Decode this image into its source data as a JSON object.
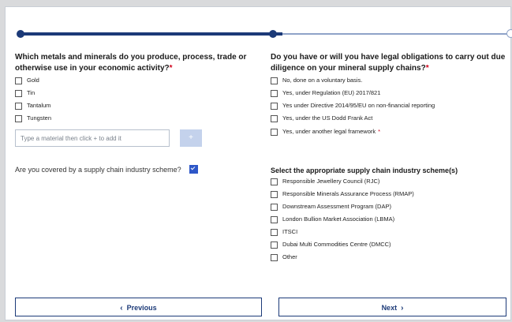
{
  "progress": {
    "current_step": 2,
    "total_steps": 3
  },
  "left": {
    "question": "Which metals and minerals do you produce, process, trade or otherwise use in your economic activity?",
    "required_mark": "*",
    "options": [
      {
        "label": "Gold",
        "checked": false
      },
      {
        "label": "Tin",
        "checked": false
      },
      {
        "label": "Tantalum",
        "checked": false
      },
      {
        "label": "Tungsten",
        "checked": false
      }
    ],
    "material_input": {
      "placeholder": "Type a material then click + to add it",
      "value": ""
    },
    "add_button_label": "+",
    "scheme_question": "Are you covered by a supply chain industry scheme?",
    "scheme_checked": true
  },
  "right": {
    "question": "Do you have or will you have legal obligations to carry out due diligence on your mineral supply chains?",
    "required_mark": "*",
    "options": [
      {
        "label": "No, done on a voluntary basis.",
        "checked": false
      },
      {
        "label": "Yes, under Regulation (EU) 2017/821",
        "checked": false
      },
      {
        "label": "Yes under Directive 2014/95/EU on non-financial reporting",
        "checked": false
      },
      {
        "label": "Yes, under the US Dodd Frank Act",
        "checked": false
      },
      {
        "label": "Yes, under another legal framework",
        "checked": false,
        "required_mark": "*"
      }
    ],
    "scheme_title": "Select the appropriate supply chain industry scheme(s)",
    "schemes": [
      {
        "label": "Responsible Jewellery Council (RJC)",
        "checked": false
      },
      {
        "label": "Responsible Minerals Assurance Process (RMAP)",
        "checked": false
      },
      {
        "label": "Downstream Assessment Program (DAP)",
        "checked": false
      },
      {
        "label": "London Bullion Market Association (LBMA)",
        "checked": false
      },
      {
        "label": "ITSCI",
        "checked": false
      },
      {
        "label": "Dubai Multi Commodities Centre (DMCC)",
        "checked": false
      },
      {
        "label": "Other",
        "checked": false
      }
    ]
  },
  "nav": {
    "previous_label": "Previous",
    "next_label": "Next",
    "prev_chevron": "‹",
    "next_chevron": "›"
  }
}
